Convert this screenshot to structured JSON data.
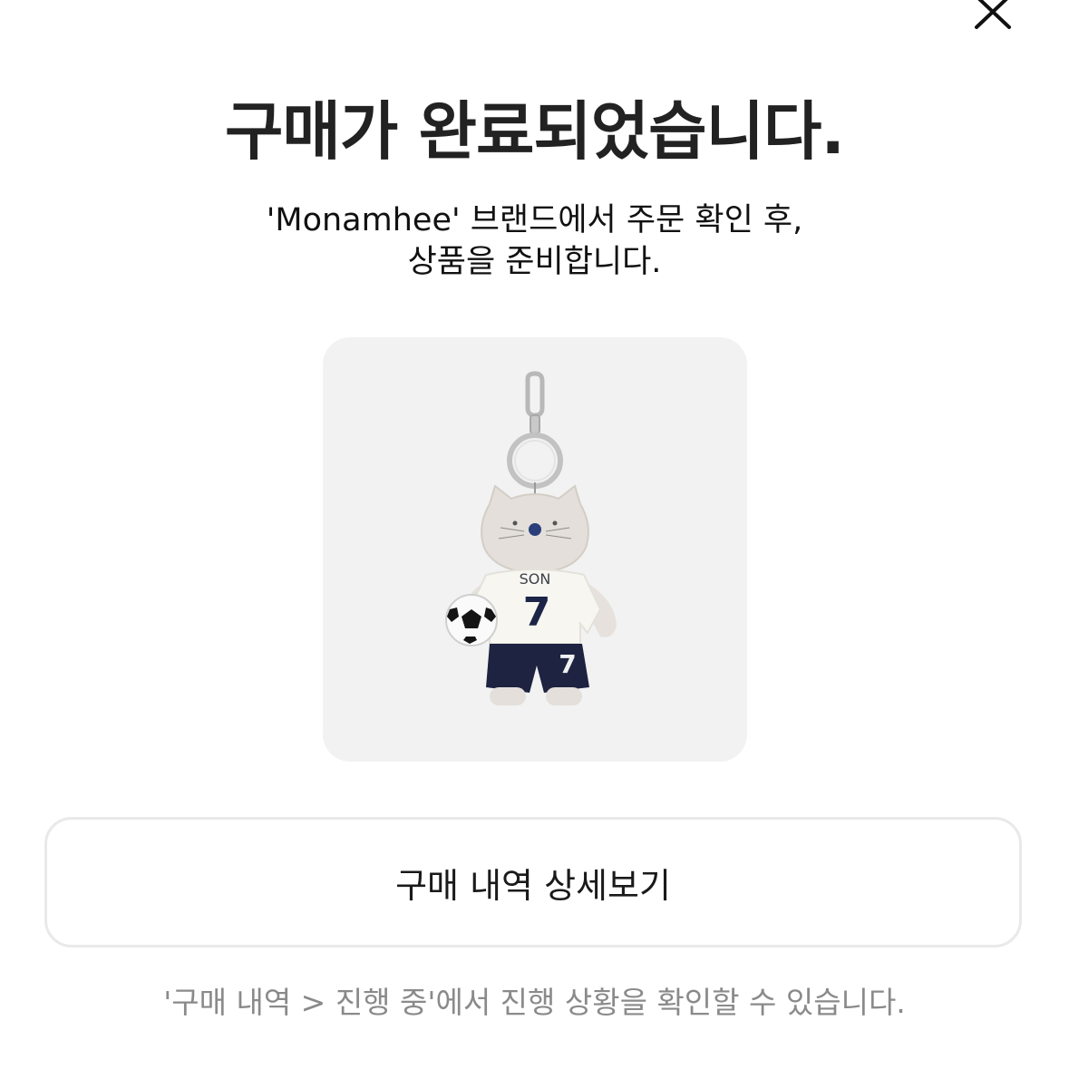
{
  "header": {
    "close_icon": "close-icon"
  },
  "completion": {
    "title": "구매가 완료되었습니다.",
    "message_line1": "'Monamhee' 브랜드에서 주문 확인 후,",
    "message_line2": "상품을 준비합니다."
  },
  "product": {
    "image_icon": "plush-keychain-image",
    "jersey_name": "SON",
    "jersey_number": "7",
    "shorts_number": "7"
  },
  "actions": {
    "detail_button_label": "구매 내역 상세보기"
  },
  "footer": {
    "note": "'구매 내역 > 진행 중'에서 진행 상황을 확인할 수 있습니다."
  },
  "colors": {
    "title": "#222222",
    "card_background": "#f2f2f2",
    "button_border": "#e9e9e9",
    "note": "#8a8a8a",
    "navy": "#1c2447"
  }
}
